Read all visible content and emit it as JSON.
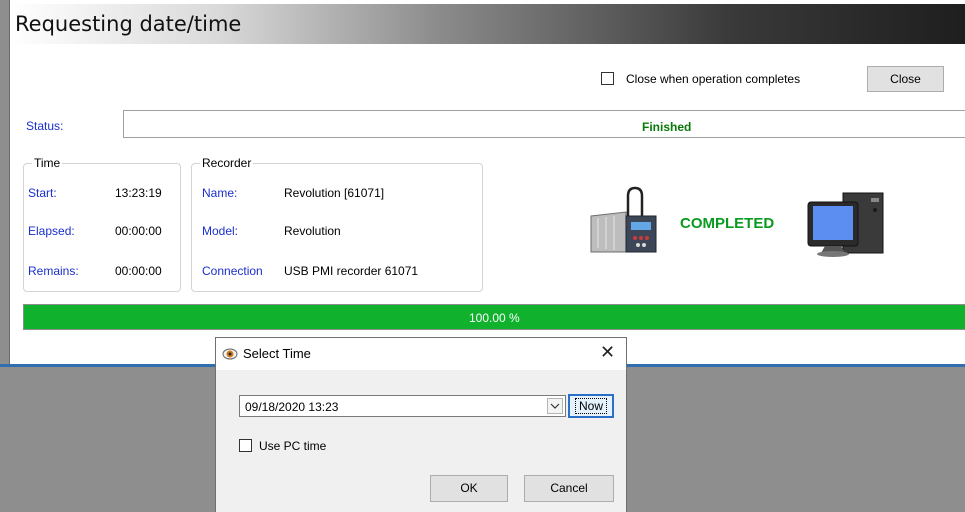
{
  "main_window": {
    "title": "Requesting date/time",
    "close_when_done_label": "Close when operation completes",
    "close_when_done_checked": false,
    "close_button_label": "Close",
    "status_label": "Status:",
    "status_value": "Finished"
  },
  "time_group": {
    "title": "Time",
    "start_label": "Start:",
    "start_value": "13:23:19",
    "elapsed_label": "Elapsed:",
    "elapsed_value": "00:00:00",
    "remains_label": "Remains:",
    "remains_value": "00:00:00"
  },
  "recorder_group": {
    "title": "Recorder",
    "name_label": "Name:",
    "name_value": "Revolution [61071]",
    "model_label": "Model:",
    "model_value": "Revolution",
    "connection_label": "Connection",
    "connection_value": "USB PMI recorder 61071"
  },
  "illustration": {
    "completed_text": "COMPLETED",
    "accent_green": "#0a9a1f"
  },
  "progress": {
    "text": "100.00 %",
    "fraction": 1.0,
    "color": "#0fb12d"
  },
  "select_time_dialog": {
    "title": "Select Time",
    "datetime_value": "09/18/2020  13:23",
    "now_button_label": "Now",
    "use_pc_time_label": "Use PC time",
    "use_pc_time_checked": false,
    "ok_button_label": "OK",
    "cancel_button_label": "Cancel",
    "close_glyph": "✕"
  }
}
